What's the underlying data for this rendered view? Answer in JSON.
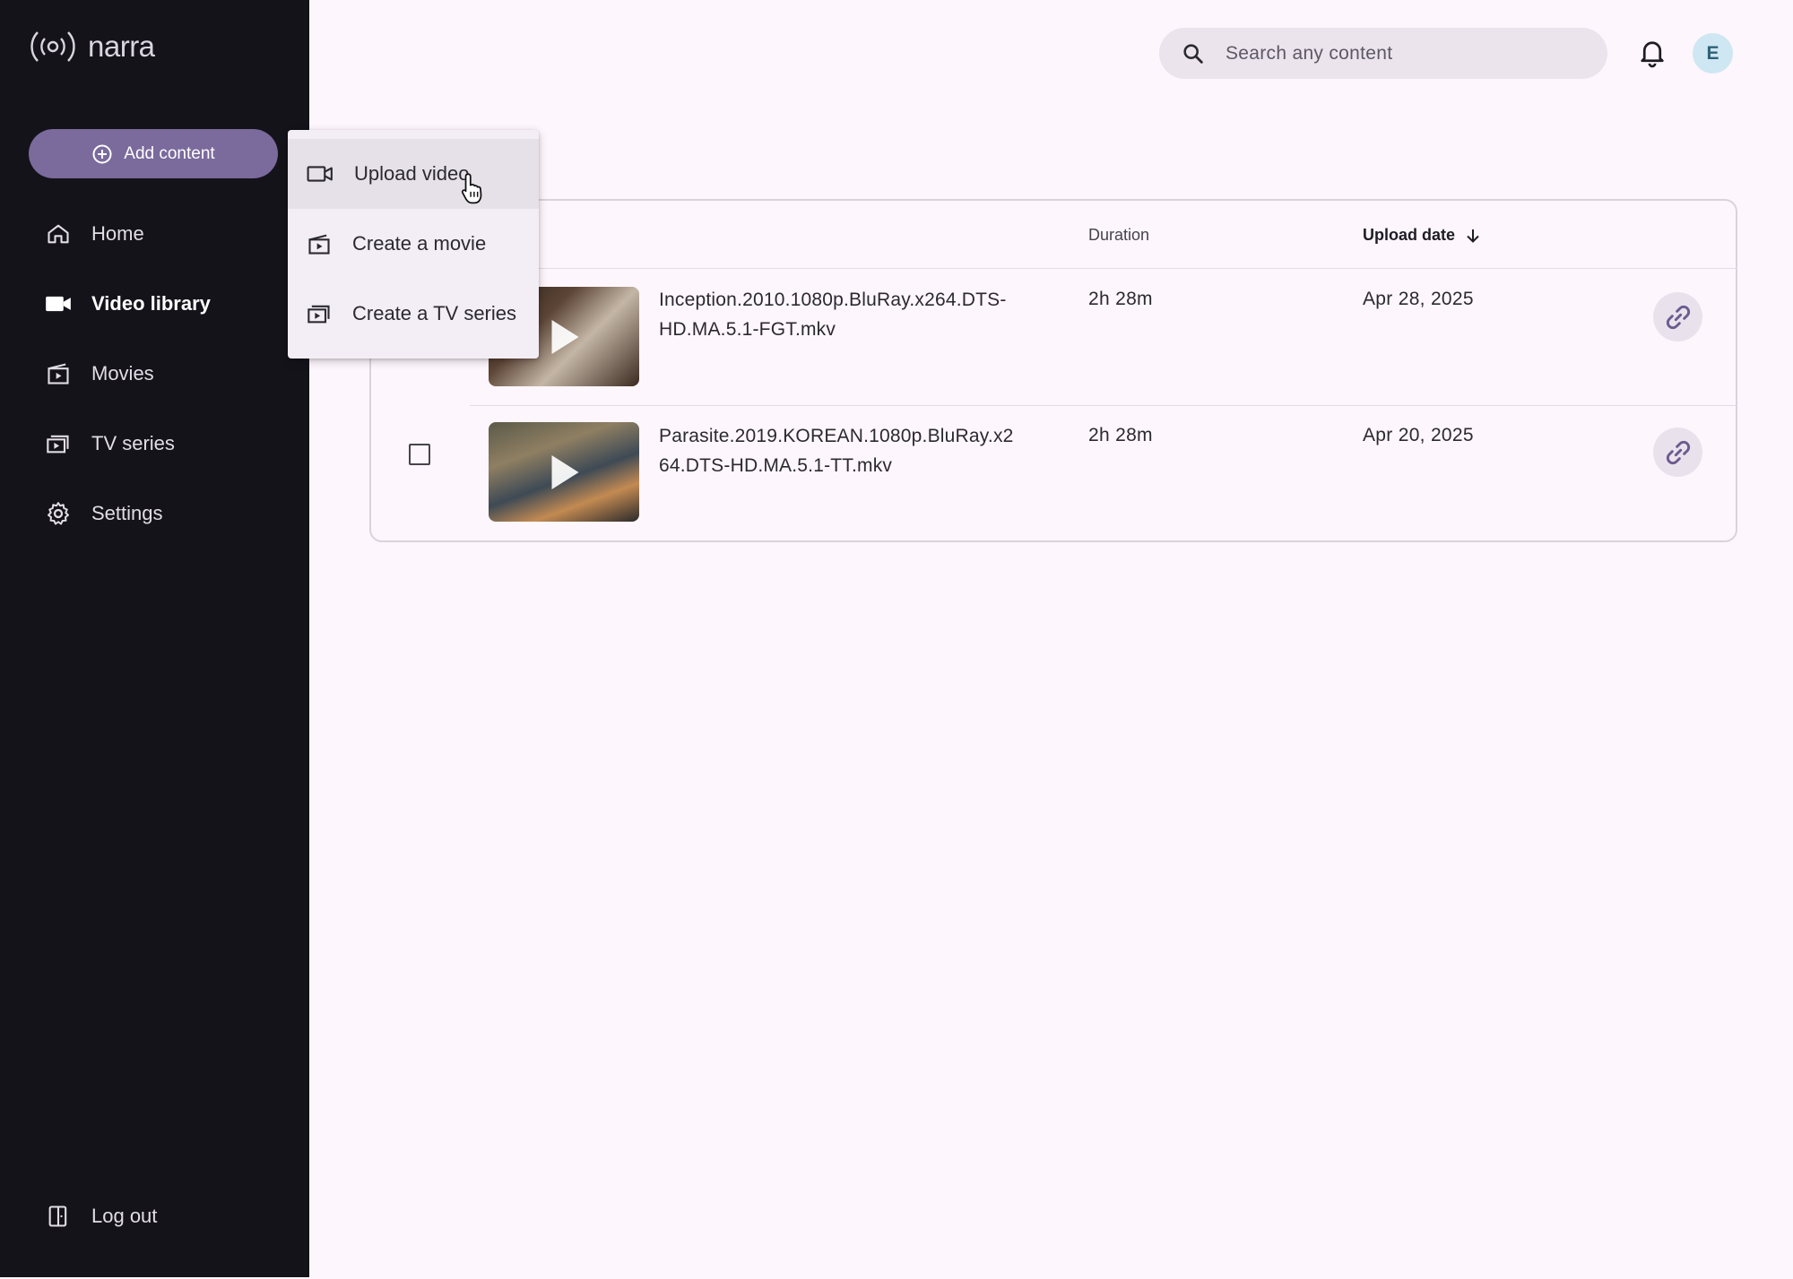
{
  "app": {
    "name": "narra"
  },
  "sidebar": {
    "add_content_label": "Add content",
    "items": [
      {
        "label": "Home",
        "icon": "home-icon"
      },
      {
        "label": "Video library",
        "icon": "video-camera-icon",
        "active": true
      },
      {
        "label": "Movies",
        "icon": "movie-icon"
      },
      {
        "label": "TV series",
        "icon": "tv-series-icon"
      },
      {
        "label": "Settings",
        "icon": "gear-icon"
      }
    ],
    "logout_label": "Log out"
  },
  "header": {
    "search_placeholder": "Search any content",
    "avatar_initial": "E"
  },
  "add_menu": {
    "items": [
      {
        "label": "Upload video",
        "icon": "video-camera-icon",
        "hovered": true
      },
      {
        "label": "Create a movie",
        "icon": "movie-icon"
      },
      {
        "label": "Create a TV series",
        "icon": "tv-series-icon"
      }
    ]
  },
  "table": {
    "columns": {
      "duration": "Duration",
      "upload_date": "Upload date"
    },
    "sort": {
      "column": "upload_date",
      "direction": "descending"
    },
    "rows": [
      {
        "filename": "Inception.2010.1080p.BluRay.x264.DTS-HD.MA.5.1-FGT.mkv",
        "filename_line1": "Inception.2010.1080p.BluRay.x264.DTS-",
        "filename_line2": "HD.MA.5.1-FGT.mkv",
        "duration": "2h 28m",
        "upload_date": "Apr 28, 2025"
      },
      {
        "filename": "Parasite.2019.KOREAN.1080p.BluRay.x264.DTS-HD.MA.5.1-TT.mkv",
        "filename_line1": "Parasite.2019.KOREAN.1080p.BluRay.x2",
        "filename_line2": "64.DTS-HD.MA.5.1-TT.mkv",
        "duration": "2h 28m",
        "upload_date": "Apr 20, 2025"
      }
    ]
  },
  "colors": {
    "sidebar_bg": "#14131a",
    "accent": "#7b6a9c",
    "page_bg": "#fdf6fc"
  }
}
